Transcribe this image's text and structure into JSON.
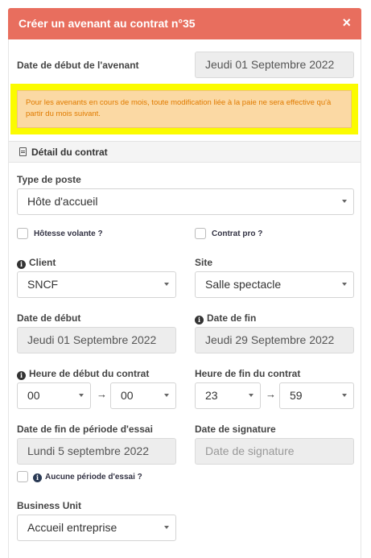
{
  "modal": {
    "title": "Créer un avenant au contrat n°35",
    "close": "×"
  },
  "avenant": {
    "start_label": "Date de début de l'avenant",
    "start_value": "Jeudi 01 Septembre 2022"
  },
  "alert": {
    "text": "Pour les avenants en cours de mois, toute modification liée à la paie ne sera effective qu'à partir du mois suivant."
  },
  "section": {
    "title": "Détail du contrat",
    "icon": "document-icon"
  },
  "job_type": {
    "label": "Type de poste",
    "value": "Hôte d'accueil"
  },
  "checkboxes": {
    "hotesse_volante": "Hôtesse volante ?",
    "contrat_pro": "Contrat pro ?",
    "no_trial": "Aucune période d'essai ?"
  },
  "client": {
    "label": "Client",
    "value": "SNCF"
  },
  "site": {
    "label": "Site",
    "value": "Salle spectacle"
  },
  "start_date": {
    "label": "Date de début",
    "value": "Jeudi 01 Septembre 2022"
  },
  "end_date": {
    "label": "Date de fin",
    "value": "Jeudi 29 Septembre 2022"
  },
  "start_time": {
    "label": "Heure de début du contrat",
    "hour": "00",
    "minute": "00"
  },
  "end_time": {
    "label": "Heure de fin du contrat",
    "hour": "23",
    "minute": "59"
  },
  "arrow": "→",
  "info_glyph": "i",
  "trial_end": {
    "label": "Date de fin de période d'essai",
    "value": "Lundi 5 septembre 2022"
  },
  "signature": {
    "label": "Date de signature",
    "placeholder": "Date de signature"
  },
  "business_unit": {
    "label": "Business Unit",
    "value": "Accueil entreprise"
  },
  "colors": {
    "header": "#e86e5e",
    "alert_bg": "#fbd9a4",
    "alert_text": "#e07b00",
    "highlight": "#fbfb00"
  }
}
